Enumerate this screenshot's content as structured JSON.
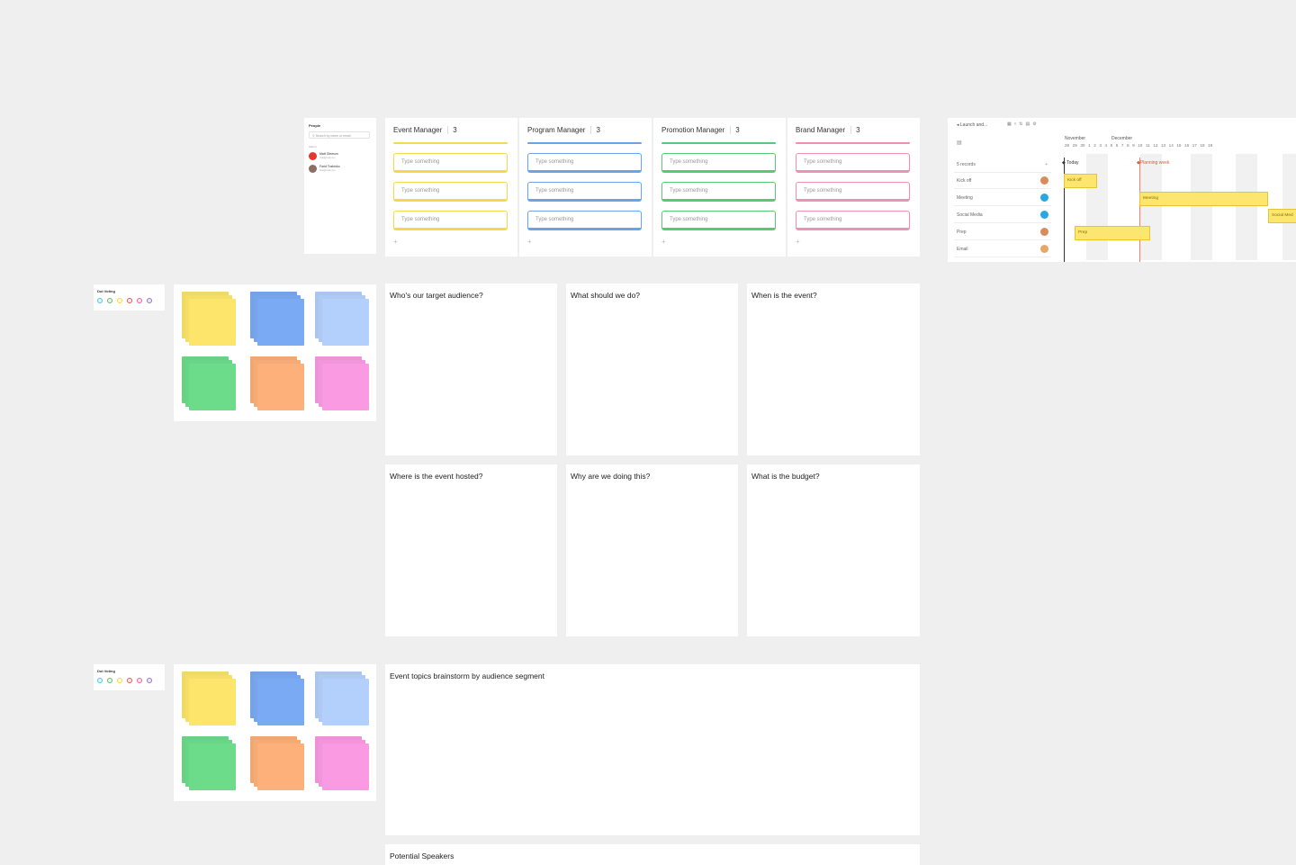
{
  "people": {
    "title": "People",
    "search_placeholder": "Search by name or email",
    "section_label": "Admin",
    "persons": [
      {
        "name": "Matt Gleeson",
        "email": "matt@mail.com",
        "avatar_color": "#e5392f"
      },
      {
        "name": "Farid Toshinko",
        "email": "farid@mail.com",
        "avatar_color": "#8d6e63"
      }
    ]
  },
  "kanban": {
    "columns": [
      {
        "title": "Event Manager",
        "count": "3",
        "color": "#f5d94b",
        "cards": [
          "Type something",
          "Type something",
          "Type something"
        ],
        "add": "+"
      },
      {
        "title": "Program Manager",
        "count": "3",
        "color": "#6aa4e8",
        "cards": [
          "Type something",
          "Type something",
          "Type something"
        ],
        "add": "+"
      },
      {
        "title": "Promotion Manager",
        "count": "3",
        "color": "#58c97a",
        "cards": [
          "Type something",
          "Type something",
          "Type something"
        ],
        "add": "+"
      },
      {
        "title": "Brand Manager",
        "count": "3",
        "color": "#ef8fb2",
        "cards": [
          "Type something",
          "Type something",
          "Type something"
        ],
        "add": "+"
      }
    ]
  },
  "gantt": {
    "project": "Launch and...",
    "records": "5 records",
    "months": [
      "November",
      "December"
    ],
    "days": "28 29 30 1 2 3 4 5 6 7 8 9 10 11 12 13 14 15 16 17 18 19",
    "today_label": "Today",
    "planning_label": "Planning week",
    "rows": [
      {
        "label": "Kick off",
        "avatar_color": "#d98b5a"
      },
      {
        "label": "Meeting",
        "avatar_color": "#29a8e0"
      },
      {
        "label": "Social Media",
        "avatar_color": "#29a8e0"
      },
      {
        "label": "Prep",
        "avatar_color": "#d98b5a"
      },
      {
        "label": "Email",
        "avatar_color": "#e6a86a"
      }
    ],
    "bars": [
      {
        "label": "Kick off"
      },
      {
        "label": "Meeting"
      },
      {
        "label": "Social Med"
      },
      {
        "label": "Prep"
      }
    ]
  },
  "dot_voting": [
    {
      "title": "Dot Voting",
      "dot_colors": [
        "#4fc3f7",
        "#66bb6a",
        "#fdd835",
        "#ef5350",
        "#f06292",
        "#9575cd"
      ]
    },
    {
      "title": "Dot Voting",
      "dot_colors": [
        "#4fc3f7",
        "#66bb6a",
        "#fdd835",
        "#ef5350",
        "#f06292",
        "#9575cd"
      ]
    }
  ],
  "sticky_colors": [
    "#fde56b",
    "#7aaaf3",
    "#b3cffb",
    "#6ddc8a",
    "#fdb07a",
    "#f99ae3"
  ],
  "questions": [
    "Who's our target audience?",
    "What should we do?",
    "When is the event?",
    "Where is the event hosted?",
    "Why are we doing this?",
    "What is the budget?"
  ],
  "brainstorm_title": "Event topics brainstorm by audience segment",
  "speakers_title": "Potential Speakers"
}
